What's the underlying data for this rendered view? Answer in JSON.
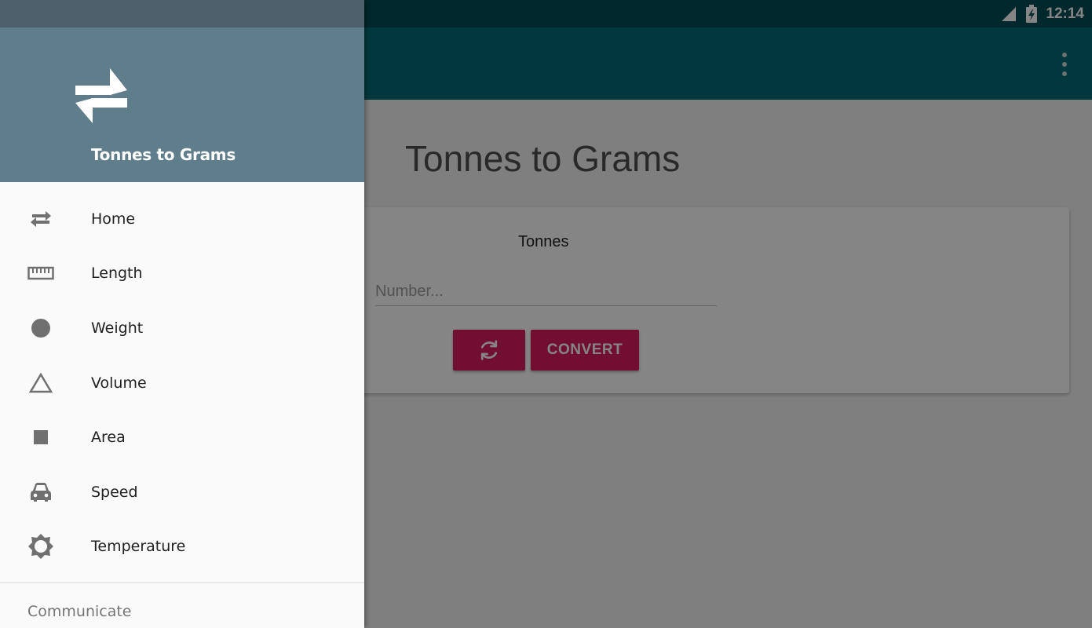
{
  "status": {
    "time": "12:14"
  },
  "main": {
    "title": "Tonnes to Grams",
    "unit_label": "Tonnes",
    "input_placeholder": "Number...",
    "convert_label": "CONVERT"
  },
  "drawer": {
    "header_title": "Tonnes to Grams",
    "items": [
      {
        "label": "Home",
        "icon": "swap-horiz-icon"
      },
      {
        "label": "Length",
        "icon": "ruler-icon"
      },
      {
        "label": "Weight",
        "icon": "circle-icon"
      },
      {
        "label": "Volume",
        "icon": "triangle-icon"
      },
      {
        "label": "Area",
        "icon": "square-icon"
      },
      {
        "label": "Speed",
        "icon": "car-icon"
      },
      {
        "label": "Temperature",
        "icon": "brightness-icon"
      }
    ],
    "section_label": "Communicate"
  },
  "colors": {
    "appbar": "#006b78",
    "status_bar": "#004d57",
    "drawer_header": "#607d8b",
    "accent": "#d81b60"
  }
}
